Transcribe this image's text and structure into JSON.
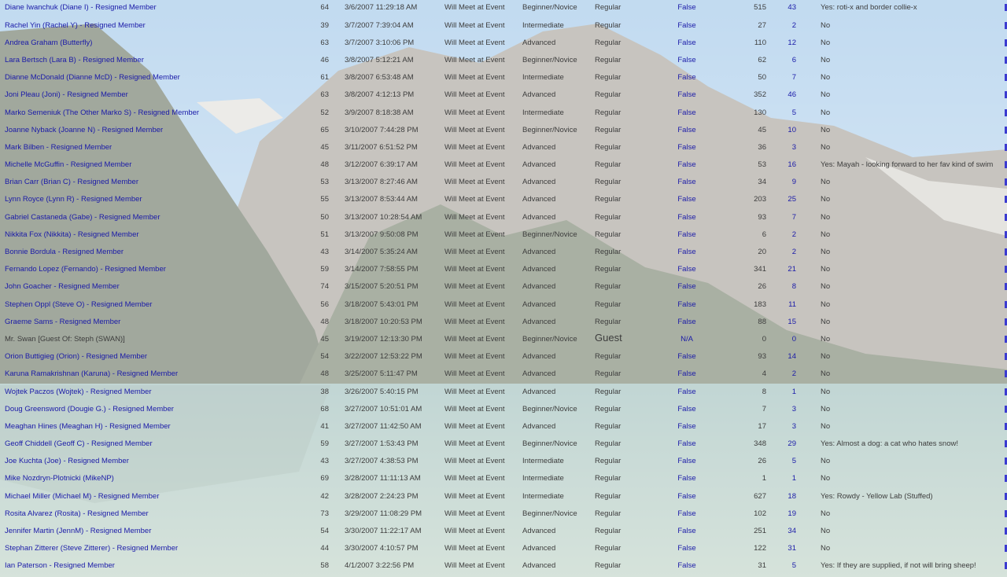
{
  "rows": [
    {
      "name": "Diane Iwanchuk (Diane I) - Resigned Member",
      "age": "64",
      "date": "3/6/2007 11:29:18 AM",
      "attend": "Will Meet at Event",
      "level": "Beginner/Novice",
      "type": "Regular",
      "flag": "False",
      "n1": "515",
      "n2": "43",
      "comment": "Yes: roti-x and border collie-x"
    },
    {
      "name": "Rachel Yin (Rachel Y) - Resigned Member",
      "age": "39",
      "date": "3/7/2007 7:39:04 AM",
      "attend": "Will Meet at Event",
      "level": "Intermediate",
      "type": "Regular",
      "flag": "False",
      "n1": "27",
      "n2": "2",
      "comment": "No"
    },
    {
      "name": "Andrea Graham (Butterfly)",
      "age": "63",
      "date": "3/7/2007 3:10:06 PM",
      "attend": "Will Meet at Event",
      "level": "Advanced",
      "type": "Regular",
      "flag": "False",
      "n1": "110",
      "n2": "12",
      "comment": "No"
    },
    {
      "name": "Lara Bertsch (Lara B) - Resigned Member",
      "age": "46",
      "date": "3/8/2007 5:12:21 AM",
      "attend": "Will Meet at Event",
      "level": "Beginner/Novice",
      "type": "Regular",
      "flag": "False",
      "n1": "62",
      "n2": "6",
      "comment": "No"
    },
    {
      "name": "Dianne McDonald (Dianne McD) - Resigned Member",
      "age": "61",
      "date": "3/8/2007 6:53:48 AM",
      "attend": "Will Meet at Event",
      "level": "Intermediate",
      "type": "Regular",
      "flag": "False",
      "n1": "50",
      "n2": "7",
      "comment": "No"
    },
    {
      "name": "Joni Pleau (Joni) - Resigned Member",
      "age": "63",
      "date": "3/8/2007 4:12:13 PM",
      "attend": "Will Meet at Event",
      "level": "Advanced",
      "type": "Regular",
      "flag": "False",
      "n1": "352",
      "n2": "46",
      "comment": "No"
    },
    {
      "name": "Marko Semeniuk (The Other Marko S) - Resigned Member",
      "age": "52",
      "date": "3/9/2007 8:18:38 AM",
      "attend": "Will Meet at Event",
      "level": "Intermediate",
      "type": "Regular",
      "flag": "False",
      "n1": "130",
      "n2": "5",
      "comment": "No"
    },
    {
      "name": "Joanne Nyback (Joanne N) - Resigned Member",
      "age": "65",
      "date": "3/10/2007 7:44:28 PM",
      "attend": "Will Meet at Event",
      "level": "Beginner/Novice",
      "type": "Regular",
      "flag": "False",
      "n1": "45",
      "n2": "10",
      "comment": "No"
    },
    {
      "name": "Mark Bilben - Resigned Member",
      "age": "45",
      "date": "3/11/2007 6:51:52 PM",
      "attend": "Will Meet at Event",
      "level": "Advanced",
      "type": "Regular",
      "flag": "False",
      "n1": "36",
      "n2": "3",
      "comment": "No"
    },
    {
      "name": "Michelle McGuffin - Resigned Member",
      "age": "48",
      "date": "3/12/2007 6:39:17 AM",
      "attend": "Will Meet at Event",
      "level": "Advanced",
      "type": "Regular",
      "flag": "False",
      "n1": "53",
      "n2": "16",
      "comment": "Yes: Mayah - looking forward to her fav kind of swim"
    },
    {
      "name": "Brian Carr (Brian C) - Resigned Member",
      "age": "53",
      "date": "3/13/2007 8:27:46 AM",
      "attend": "Will Meet at Event",
      "level": "Advanced",
      "type": "Regular",
      "flag": "False",
      "n1": "34",
      "n2": "9",
      "comment": "No"
    },
    {
      "name": "Lynn Royce (Lynn R) - Resigned Member",
      "age": "55",
      "date": "3/13/2007 8:53:44 AM",
      "attend": "Will Meet at Event",
      "level": "Advanced",
      "type": "Regular",
      "flag": "False",
      "n1": "203",
      "n2": "25",
      "comment": "No"
    },
    {
      "name": "Gabriel Castaneda (Gabe) - Resigned Member",
      "age": "50",
      "date": "3/13/2007 10:28:54 AM",
      "attend": "Will Meet at Event",
      "level": "Advanced",
      "type": "Regular",
      "flag": "False",
      "n1": "93",
      "n2": "7",
      "comment": "No"
    },
    {
      "name": "Nikkita Fox (Nikkita) - Resigned Member",
      "age": "51",
      "date": "3/13/2007 9:50:08 PM",
      "attend": "Will Meet at Event",
      "level": "Beginner/Novice",
      "type": "Regular",
      "flag": "False",
      "n1": "6",
      "n2": "2",
      "comment": "No"
    },
    {
      "name": "Bonnie Bordula - Resigned Member",
      "age": "43",
      "date": "3/14/2007 5:35:24 AM",
      "attend": "Will Meet at Event",
      "level": "Advanced",
      "type": "Regular",
      "flag": "False",
      "n1": "20",
      "n2": "2",
      "comment": "No"
    },
    {
      "name": "Fernando Lopez (Fernando) - Resigned Member",
      "age": "59",
      "date": "3/14/2007 7:58:55 PM",
      "attend": "Will Meet at Event",
      "level": "Advanced",
      "type": "Regular",
      "flag": "False",
      "n1": "341",
      "n2": "21",
      "comment": "No"
    },
    {
      "name": "John Goacher - Resigned Member",
      "age": "74",
      "date": "3/15/2007 5:20:51 PM",
      "attend": "Will Meet at Event",
      "level": "Advanced",
      "type": "Regular",
      "flag": "False",
      "n1": "26",
      "n2": "8",
      "comment": "No"
    },
    {
      "name": "Stephen Oppl (Steve O) - Resigned Member",
      "age": "56",
      "date": "3/18/2007 5:43:01 PM",
      "attend": "Will Meet at Event",
      "level": "Advanced",
      "type": "Regular",
      "flag": "False",
      "n1": "183",
      "n2": "11",
      "comment": "No"
    },
    {
      "name": "Graeme Sams - Resigned Member",
      "age": "48",
      "date": "3/18/2007 10:20:53 PM",
      "attend": "Will Meet at Event",
      "level": "Advanced",
      "type": "Regular",
      "flag": "False",
      "n1": "88",
      "n2": "15",
      "comment": "No"
    },
    {
      "name": "Mr. Swan [Guest Of: Steph (SWAN)]",
      "age": "45",
      "date": "3/19/2007 12:13:30 PM",
      "attend": "Will Meet at Event",
      "level": "Beginner/Novice",
      "type": "Guest",
      "flag": "N/A",
      "n1": "0",
      "n2": "0",
      "comment": "No",
      "guest": true
    },
    {
      "name": "Orion Buttigieg (Orion) - Resigned Member",
      "age": "54",
      "date": "3/22/2007 12:53:22 PM",
      "attend": "Will Meet at Event",
      "level": "Advanced",
      "type": "Regular",
      "flag": "False",
      "n1": "93",
      "n2": "14",
      "comment": "No"
    },
    {
      "name": "Karuna Ramakrishnan (Karuna) - Resigned Member",
      "age": "48",
      "date": "3/25/2007 5:11:47 PM",
      "attend": "Will Meet at Event",
      "level": "Advanced",
      "type": "Regular",
      "flag": "False",
      "n1": "4",
      "n2": "2",
      "comment": "No"
    },
    {
      "name": "Wojtek Paczos (Wojtek) - Resigned Member",
      "age": "38",
      "date": "3/26/2007 5:40:15 PM",
      "attend": "Will Meet at Event",
      "level": "Advanced",
      "type": "Regular",
      "flag": "False",
      "n1": "8",
      "n2": "1",
      "comment": "No"
    },
    {
      "name": "Doug Greensword (Dougie G.) - Resigned Member",
      "age": "68",
      "date": "3/27/2007 10:51:01 AM",
      "attend": "Will Meet at Event",
      "level": "Beginner/Novice",
      "type": "Regular",
      "flag": "False",
      "n1": "7",
      "n2": "3",
      "comment": "No"
    },
    {
      "name": "Meaghan Hines (Meaghan H) - Resigned Member",
      "age": "41",
      "date": "3/27/2007 11:42:50 AM",
      "attend": "Will Meet at Event",
      "level": "Advanced",
      "type": "Regular",
      "flag": "False",
      "n1": "17",
      "n2": "3",
      "comment": "No"
    },
    {
      "name": "Geoff Chiddell (Geoff C) - Resigned Member",
      "age": "59",
      "date": "3/27/2007 1:53:43 PM",
      "attend": "Will Meet at Event",
      "level": "Beginner/Novice",
      "type": "Regular",
      "flag": "False",
      "n1": "348",
      "n2": "29",
      "comment": "Yes: Almost a dog: a cat who hates snow!"
    },
    {
      "name": "Joe Kuchta (Joe) - Resigned Member",
      "age": "43",
      "date": "3/27/2007 4:38:53 PM",
      "attend": "Will Meet at Event",
      "level": "Intermediate",
      "type": "Regular",
      "flag": "False",
      "n1": "26",
      "n2": "5",
      "comment": "No"
    },
    {
      "name": "Mike Nozdryn-Plotnicki (MikeNP)",
      "age": "69",
      "date": "3/28/2007 11:11:13 AM",
      "attend": "Will Meet at Event",
      "level": "Intermediate",
      "type": "Regular",
      "flag": "False",
      "n1": "1",
      "n2": "1",
      "comment": "No"
    },
    {
      "name": "Michael Miller (Michael M) - Resigned Member",
      "age": "42",
      "date": "3/28/2007 2:24:23 PM",
      "attend": "Will Meet at Event",
      "level": "Intermediate",
      "type": "Regular",
      "flag": "False",
      "n1": "627",
      "n2": "18",
      "comment": "Yes: Rowdy - Yellow Lab (Stuffed)"
    },
    {
      "name": "Rosita Alvarez (Rosita) - Resigned Member",
      "age": "73",
      "date": "3/29/2007 11:08:29 PM",
      "attend": "Will Meet at Event",
      "level": "Beginner/Novice",
      "type": "Regular",
      "flag": "False",
      "n1": "102",
      "n2": "19",
      "comment": "No"
    },
    {
      "name": "Jennifer Martin (JennM) - Resigned Member",
      "age": "54",
      "date": "3/30/2007 11:22:17 AM",
      "attend": "Will Meet at Event",
      "level": "Advanced",
      "type": "Regular",
      "flag": "False",
      "n1": "251",
      "n2": "34",
      "comment": "No"
    },
    {
      "name": "Stephan Zitterer (Steve Zitterer) - Resigned Member",
      "age": "44",
      "date": "3/30/2007 4:10:57 PM",
      "attend": "Will Meet at Event",
      "level": "Advanced",
      "type": "Regular",
      "flag": "False",
      "n1": "122",
      "n2": "31",
      "comment": "No"
    },
    {
      "name": "Ian Paterson - Resigned Member",
      "age": "58",
      "date": "4/1/2007 3:22:56 PM",
      "attend": "Will Meet at Event",
      "level": "Advanced",
      "type": "Regular",
      "flag": "False",
      "n1": "31",
      "n2": "5",
      "comment": "Yes: If they are supplied, if not will bring sheep!"
    }
  ]
}
